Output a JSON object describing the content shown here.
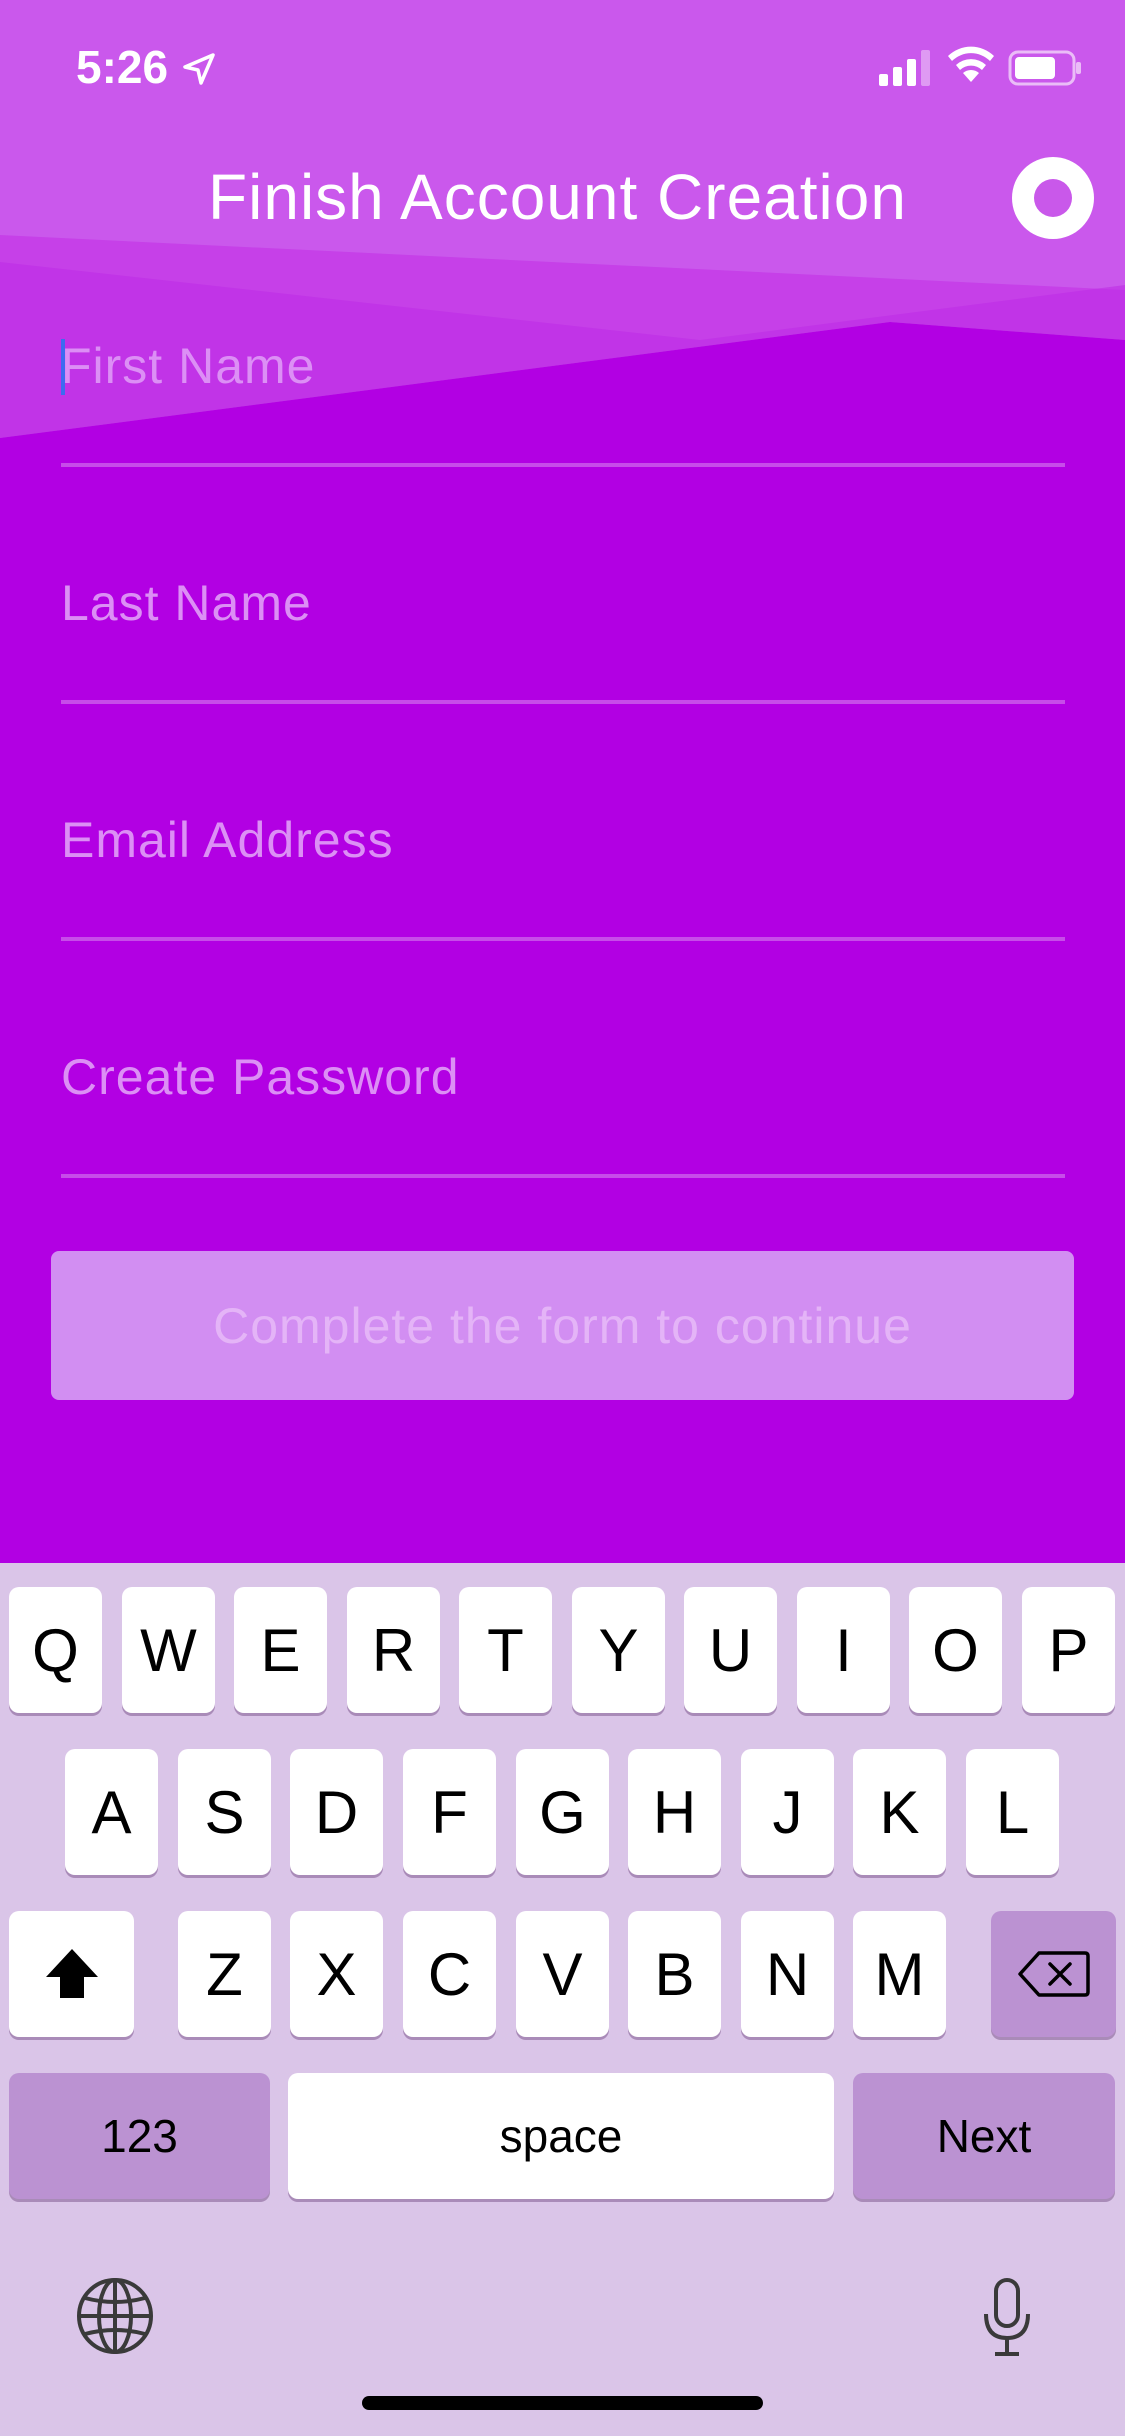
{
  "status_bar": {
    "time": "5:26"
  },
  "header": {
    "title": "Finish Account Creation"
  },
  "form": {
    "fields": [
      {
        "placeholder": "First Name",
        "focused": true
      },
      {
        "placeholder": "Last Name",
        "focused": false
      },
      {
        "placeholder": "Email Address",
        "focused": false
      },
      {
        "placeholder": "Create Password",
        "focused": false
      }
    ],
    "submit_label": "Complete the form to continue"
  },
  "keyboard": {
    "row1": [
      "Q",
      "W",
      "E",
      "R",
      "T",
      "Y",
      "U",
      "I",
      "O",
      "P"
    ],
    "row2": [
      "A",
      "S",
      "D",
      "F",
      "G",
      "H",
      "J",
      "K",
      "L"
    ],
    "row3": [
      "Z",
      "X",
      "C",
      "V",
      "B",
      "N",
      "M"
    ],
    "numbers_label": "123",
    "space_label": "space",
    "next_label": "Next",
    "icons": {
      "shift": "shift-icon",
      "delete": "backspace-icon",
      "globe": "globe-icon",
      "mic": "microphone-icon"
    }
  },
  "colors": {
    "background": "#b200e3",
    "header": "#c958ea",
    "keyboard": "#dac5e8"
  }
}
